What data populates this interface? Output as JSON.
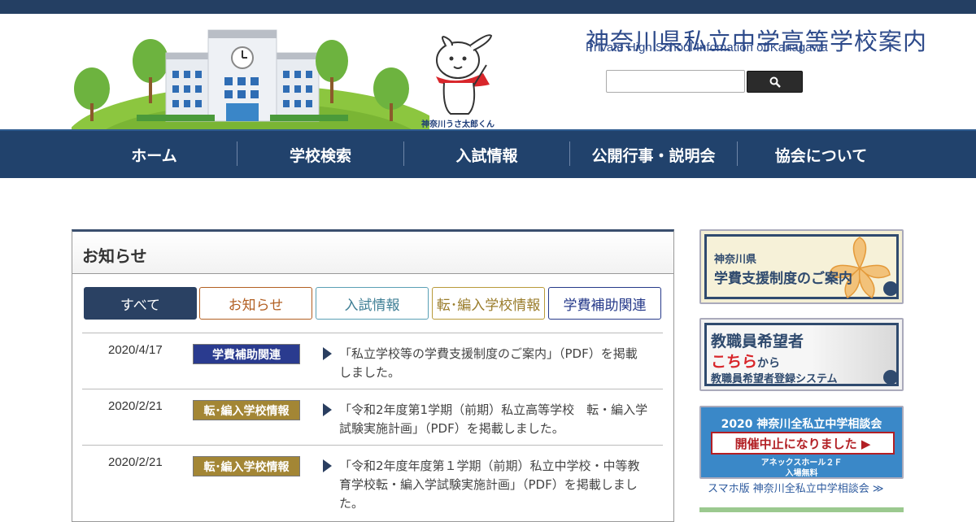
{
  "header": {
    "title": "神奈川県私立中学高等学校案内",
    "subtitle": "Private High School Infomation of Kanagawa",
    "mascot_caption": "神奈川うさ太郎くん",
    "search": {
      "value": "",
      "placeholder": ""
    }
  },
  "nav": {
    "items": [
      {
        "label": "ホーム"
      },
      {
        "label": "学校検索"
      },
      {
        "label": "入試情報"
      },
      {
        "label": "公開行事・説明会"
      },
      {
        "label": "協会について"
      }
    ]
  },
  "news": {
    "title": "お知らせ",
    "tabs": [
      {
        "label": "すべて",
        "active": true
      },
      {
        "label": "お知らせ"
      },
      {
        "label": "入試情報"
      },
      {
        "label": "転･編入学校情報"
      },
      {
        "label": "学費補助関連"
      }
    ],
    "items": [
      {
        "date": "2020/4/17",
        "category": "学費補助関連",
        "category_color": "#2a3b8f",
        "text": "「私立学校等の学費支援制度のご案内」（PDF）を掲載しました。"
      },
      {
        "date": "2020/2/21",
        "category": "転･編入学校情報",
        "category_color": "#a38635",
        "text": "「令和2年度第1学期（前期）私立高等学校　転・編入学試験実施計画」（PDF）を掲載しました。"
      },
      {
        "date": "2020/2/21",
        "category": "転･編入学校情報",
        "category_color": "#a38635",
        "text": "「令和2年度年度第１学期（前期）私立中学校・中等教育学校転・編入学試験実施計画」（PDF）を掲載しました。"
      }
    ]
  },
  "sidebar": {
    "banner1": {
      "line1": "神奈川県",
      "line2": "学費支援制度のご案内"
    },
    "banner2": {
      "line1": "教職員希望者",
      "line2a": "こちら",
      "line2b": "から",
      "line3": "教職員希望者登録システム"
    },
    "banner3": {
      "line1": "2020 神奈川全私立中学相談会",
      "line2": "開催中止になりました ▶",
      "line3": "アネックスホール２Ｆ",
      "line4": "入場無料"
    },
    "link": "スマホ版 神奈川全私立中学相談会 ≫"
  },
  "colors": {
    "nav_bg": "#21426c",
    "topbar": "#243f63",
    "tab_active_bg": "#2a4163",
    "title_blue": "#2d4a8a"
  }
}
